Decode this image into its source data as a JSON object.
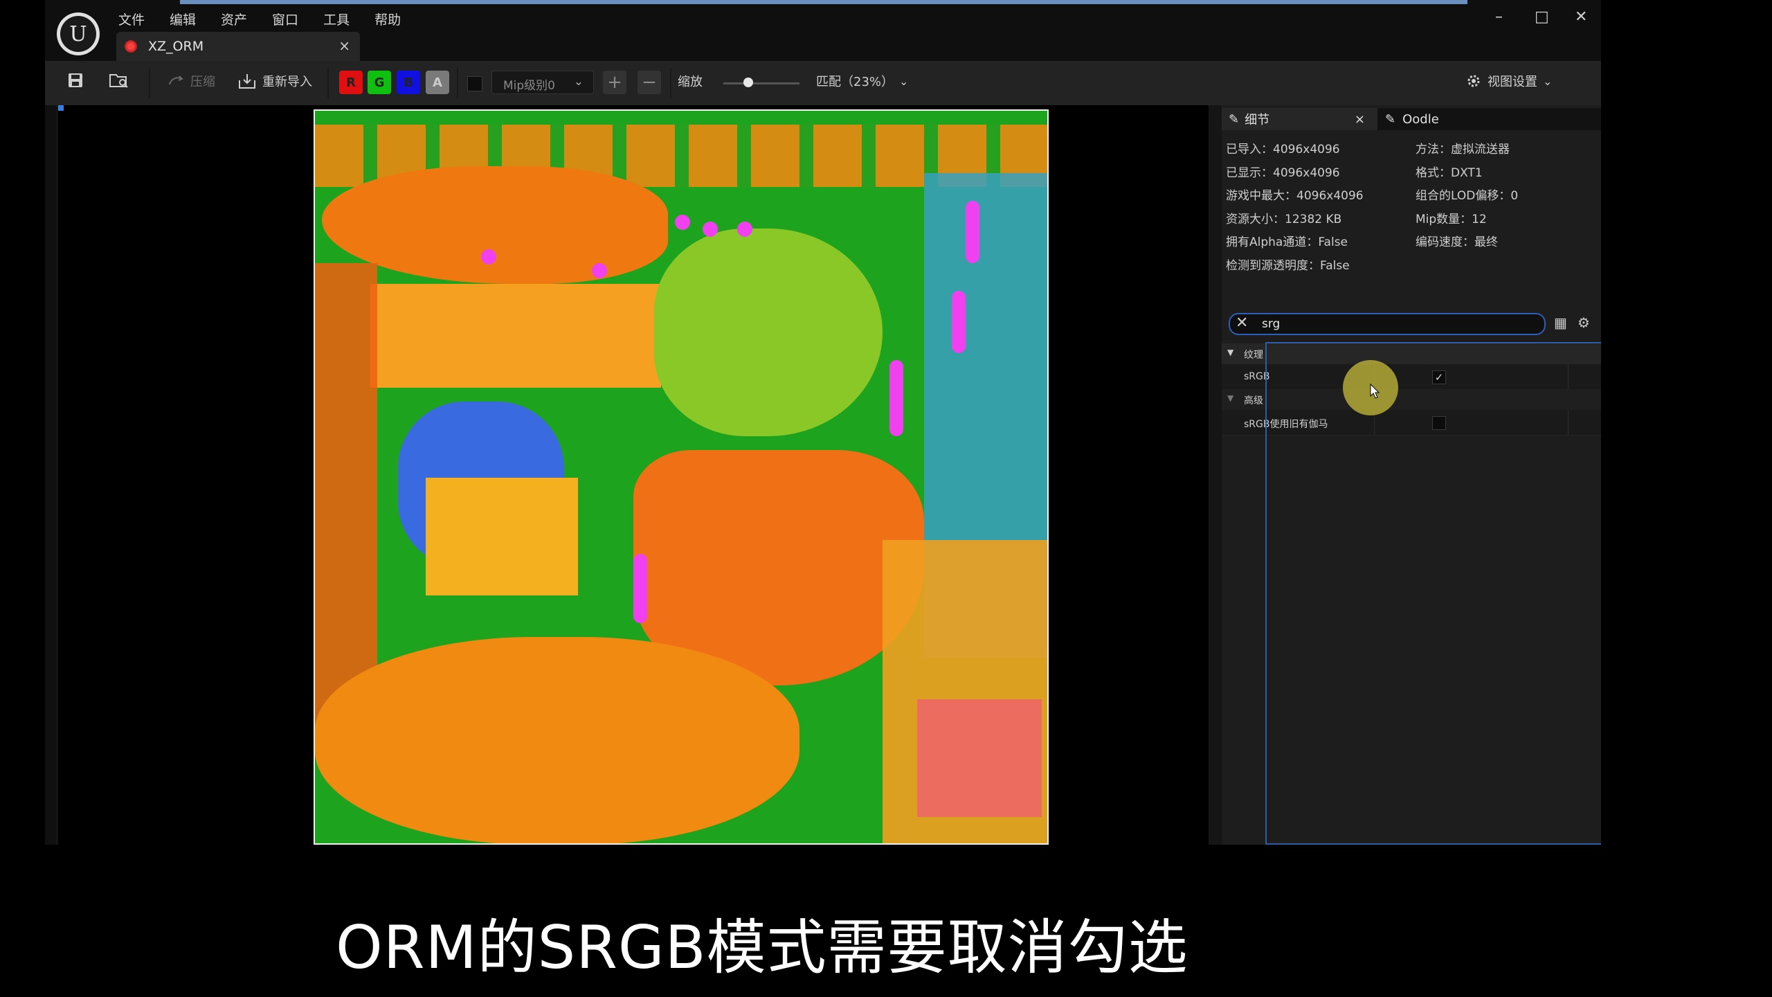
{
  "window": {
    "menu": [
      "文件",
      "编辑",
      "资产",
      "窗口",
      "工具",
      "帮助"
    ],
    "controls": {
      "minimize": "–",
      "maximize": "□",
      "close": "✕"
    },
    "tab": {
      "title": "XZ_ORM",
      "close": "×"
    }
  },
  "toolbar": {
    "compress": "压缩",
    "reimport": "重新导入",
    "channels": [
      {
        "label": "R",
        "color": "#e01010"
      },
      {
        "label": "G",
        "color": "#10c010"
      },
      {
        "label": "B",
        "color": "#1010e0"
      },
      {
        "label": "A",
        "color": "#7a7a7a"
      }
    ],
    "mip_select": "Mip级别0",
    "zoom_label": "缩放",
    "fit_label": "匹配（23%）",
    "view_settings": "视图设置"
  },
  "details": {
    "tabs": [
      {
        "label": "细节",
        "close": "×"
      },
      {
        "label": "Oodle"
      }
    ],
    "info_left": [
      "已导入：4096x4096",
      "已显示：4096x4096",
      "游戏中最大：4096x4096",
      "资源大小：12382 KB",
      "拥有Alpha通道：False",
      "检测到源透明度：False"
    ],
    "info_right": [
      "方法：虚拟流送器",
      "格式：DXT1",
      "组合的LOD偏移：0",
      "Mip数量：12",
      "编码速度：最终"
    ],
    "search_value": "srg",
    "sections": [
      {
        "title": "纹理",
        "rows": [
          {
            "label": "sRGB",
            "checked": true
          }
        ]
      },
      {
        "title": "高级",
        "rows": [
          {
            "label": "sRGB使用旧有伽马",
            "checked": false
          }
        ]
      }
    ]
  },
  "subtitle": "ORM的SRGB模式需要取消勾选"
}
